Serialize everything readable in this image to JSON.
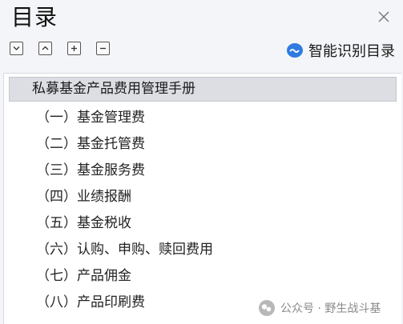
{
  "header": {
    "title": "目录"
  },
  "toolbar": {
    "collapse_icon": "chevron-down-icon",
    "expand_icon": "chevron-up-icon",
    "add_icon": "plus-icon",
    "remove_icon": "minus-icon",
    "smart_label": "智能识别目录"
  },
  "toc": {
    "root": "私募基金产品费用管理手册",
    "items": [
      "（一）基金管理费",
      "（二）基金托管费",
      "（三）基金服务费",
      "（四）业绩报酬",
      "（五）基金税收",
      "（六）认购、申购、赎回费用",
      "（七）产品佣金",
      "（八）产品印刷费"
    ]
  },
  "watermark": {
    "text": "公众号 · 野生战斗基"
  },
  "colors": {
    "accent": "#2f7be0",
    "selected_bg": "#dcdee3",
    "panel_bg": "#f4f5f8"
  }
}
